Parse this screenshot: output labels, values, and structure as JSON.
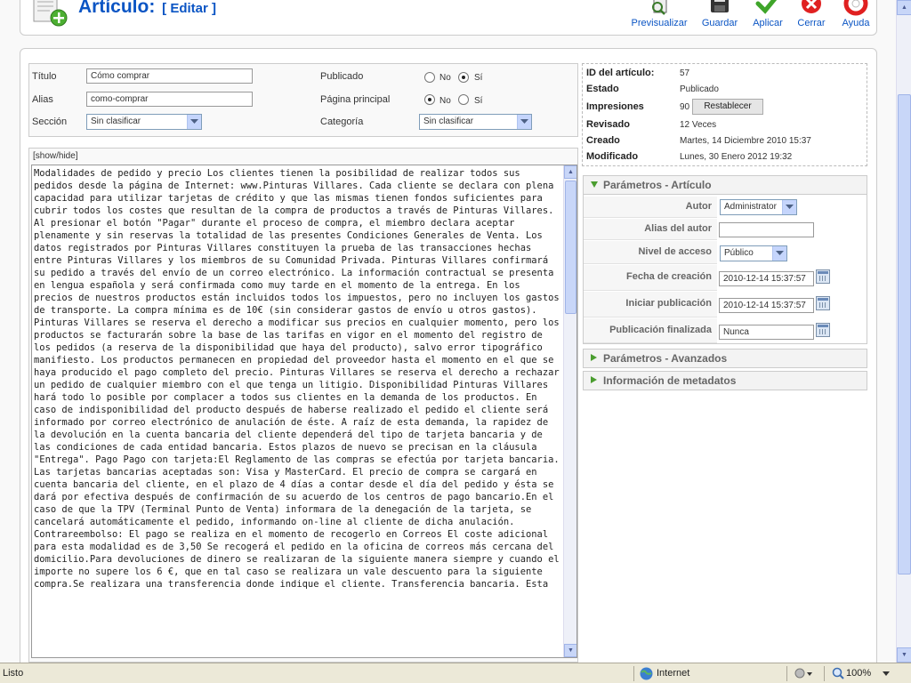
{
  "header": {
    "title": "Artículo:",
    "subtitle": "[ Editar ]",
    "toolbar": [
      {
        "label": "Previsualizar",
        "icon": "preview-icon"
      },
      {
        "label": "Guardar",
        "icon": "save-icon"
      },
      {
        "label": "Aplicar",
        "icon": "apply-icon"
      },
      {
        "label": "Cerrar",
        "icon": "close-icon"
      },
      {
        "label": "Ayuda",
        "icon": "help-icon"
      }
    ]
  },
  "details": {
    "titulo_label": "Título",
    "titulo_value": "Cómo comprar",
    "alias_label": "Alias",
    "alias_value": "como-comprar",
    "seccion_label": "Sección",
    "seccion_value": "Sin clasificar",
    "publicado_label": "Publicado",
    "publicado_no": "No",
    "publicado_si": "Sí",
    "pagina_label": "Página principal",
    "pagina_no": "No",
    "pagina_si": "Sí",
    "categoria_label": "Categoría",
    "categoria_value": "Sin clasificar",
    "publicado_selected": "Sí",
    "pagina_selected": "No"
  },
  "editor": {
    "toggle": "[show/hide]",
    "text": "Modalidades de pedido y precio Los clientes tienen la posibilidad de realizar todos sus pedidos desde la página de Internet: www.Pinturas Villares. Cada cliente se declara con plena capacidad para utilizar tarjetas de crédito y que las mismas tienen fondos suficientes para cubrir todos los costes que resultan de la compra de productos a través de Pinturas Villares. Al presionar el botón \"Pagar\" durante el proceso de compra, el miembro declara aceptar plenamente y sin reservas la totalidad de las presentes Condiciones Generales de Venta. Los datos registrados por Pinturas Villares constituyen la prueba de las transacciones hechas entre Pinturas Villares y los miembros de su Comunidad Privada. Pinturas Villares confirmará su pedido a través del envío de un correo electrónico. La información contractual se presenta en lengua española y será confirmada como muy tarde en el momento de la entrega. En los precios de nuestros productos están incluidos todos los impuestos, pero no incluyen los gastos de transporte. La compra mínima es de 10€ (sin considerar gastos de envío u otros gastos). Pinturas Villares se reserva el derecho a modificar sus precios en cualquier momento, pero los productos se facturarán sobre la base de las tarifas en vigor en el momento del registro de los pedidos (a reserva de la disponibilidad que haya del producto), salvo error tipográfico manifiesto. Los productos permanecen en propiedad del proveedor hasta el momento en el que se haya producido el pago completo del precio. Pinturas Villares se reserva el derecho a rechazar un pedido de cualquier miembro con el que tenga un litigio. Disponibilidad Pinturas Villares hará todo lo posible por complacer a todos sus clientes en la demanda de los productos. En caso de indisponibilidad del producto después de haberse realizado el pedido el cliente será informado por correo electrónico de anulación de éste. A raíz de esta demanda, la rapidez de la devolución en la cuenta bancaria del cliente dependerá del tipo de tarjeta bancaria y de las condiciones de cada entidad bancaria. Estos plazos de nuevo se precisan en la cláusula \"Entrega\". Pago Pago con tarjeta:El Reglamento de las compras se efectúa por tarjeta bancaria. Las tarjetas bancarias aceptadas son: Visa y MasterCard. El precio de compra se cargará en cuenta bancaria del cliente, en el plazo de 4 días a contar desde el día del pedido y ésta se dará por efectiva después de confirmación de su acuerdo de los centros de pago bancario.En el caso de que la TPV (Terminal Punto de Venta) informara de la denegación de la tarjeta, se cancelará automáticamente el pedido, informando on-line al cliente de dicha anulación. Contrareembolso: El pago se realiza en el momento de recogerlo en Correos El coste adicional para esta modalidad es de 3,50 Se recogerá el pedido en la oficina de correos más cercana del domicilio.Para devoluciones de dinero se realizaran de la siguiente manera siempre y cuando el importe no supere los 6 €, que en tal caso se realizara un vale descuento para la siguiente compra.Se realizara una transferencia donde indique el cliente. Transferencia bancaria. Esta"
  },
  "info": {
    "id_label": "ID del artículo:",
    "id_value": "57",
    "estado_label": "Estado",
    "estado_value": "Publicado",
    "impresiones_label": "Impresiones",
    "impresiones_value": "90",
    "reset_label": "Restablecer",
    "revisado_label": "Revisado",
    "revisado_value": "12 Veces",
    "creado_label": "Creado",
    "creado_value": "Martes, 14 Diciembre 2010 15:37",
    "modificado_label": "Modificado",
    "modificado_value": "Lunes, 30 Enero 2012 19:32"
  },
  "params": {
    "header": "Parámetros - Artículo",
    "autor_label": "Autor",
    "autor_value": "Administrator",
    "alias_autor_label": "Alias del autor",
    "alias_autor_value": "",
    "nivel_label": "Nivel de acceso",
    "nivel_value": "Público",
    "fecha_label": "Fecha de creación",
    "fecha_value": "2010-12-14 15:37:57",
    "iniciar_label": "Iniciar publicación",
    "iniciar_value": "2010-12-14 15:37:57",
    "fin_label": "Publicación finalizada",
    "fin_value": "Nunca"
  },
  "panels": {
    "avanzados": "Parámetros - Avanzados",
    "metadatos": "Información de metadatos"
  },
  "statusbar": {
    "status": "Listo",
    "zone": "Internet",
    "zoom": "100%"
  },
  "colors": {
    "link_blue": "#0b55c4",
    "panel_arrow_green": "#4a9d2f",
    "statusbar_bg": "#ece9d8"
  }
}
